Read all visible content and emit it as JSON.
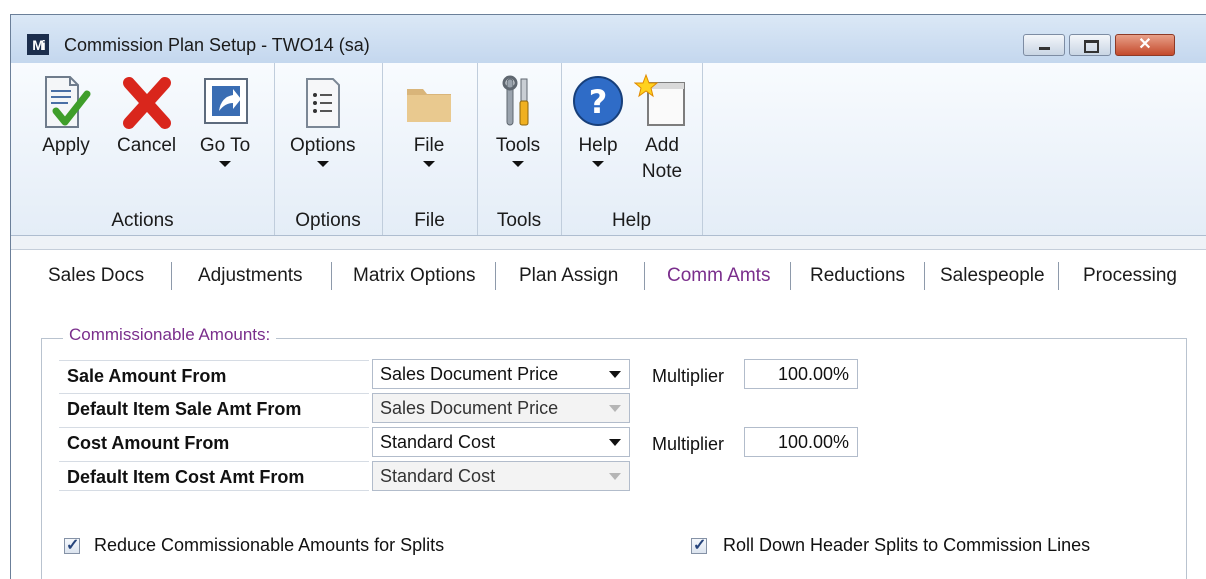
{
  "window": {
    "logo": "Mi",
    "title": "Commission Plan Setup  -  TWO14 (sa)",
    "close_glyph": "✕"
  },
  "ribbon": {
    "groups": [
      {
        "label": "Actions",
        "buttons": [
          {
            "label": "Apply",
            "icon": "apply-check-icon"
          },
          {
            "label": "Cancel",
            "icon": "cancel-x-icon"
          },
          {
            "label": "Go To",
            "icon": "goto-arrow-icon",
            "dropdown": true
          }
        ]
      },
      {
        "label": "Options",
        "buttons": [
          {
            "label": "Options",
            "icon": "options-list-icon",
            "dropdown": true
          }
        ]
      },
      {
        "label": "File",
        "buttons": [
          {
            "label": "File",
            "icon": "folder-icon",
            "dropdown": true
          }
        ]
      },
      {
        "label": "Tools",
        "buttons": [
          {
            "label": "Tools",
            "icon": "tools-icon",
            "dropdown": true
          }
        ]
      },
      {
        "label": "Help",
        "buttons": [
          {
            "label": "Help",
            "icon": "help-icon",
            "dropdown": true
          },
          {
            "label": "Add Note",
            "icon": "add-note-icon"
          }
        ]
      }
    ]
  },
  "tabs": [
    {
      "label": "Sales Docs"
    },
    {
      "label": "Adjustments"
    },
    {
      "label": "Matrix Options"
    },
    {
      "label": "Plan Assign"
    },
    {
      "label": "Comm Amts",
      "active": true
    },
    {
      "label": "Reductions"
    },
    {
      "label": "Salespeople"
    },
    {
      "label": "Processing"
    }
  ],
  "section": {
    "title": "Commissionable Amounts:",
    "rows": [
      {
        "label": "Sale Amount From",
        "value": "Sales Document Price",
        "enabled": true,
        "multiplier_label": "Multiplier",
        "multiplier": "100.00%"
      },
      {
        "label": "Default Item Sale Amt From",
        "value": "Sales Document Price",
        "enabled": false
      },
      {
        "label": "Cost Amount From",
        "value": "Standard Cost",
        "enabled": true,
        "multiplier_label": "Multiplier",
        "multiplier": "100.00%"
      },
      {
        "label": "Default Item Cost Amt From",
        "value": "Standard Cost",
        "enabled": false
      }
    ],
    "checkboxes": [
      {
        "label": "Reduce Commissionable Amounts for Splits",
        "checked": true
      },
      {
        "label": "Roll Down Header Splits to Commission Lines",
        "checked": true
      }
    ]
  },
  "colors": {
    "accent_purple": "#7a2e8c",
    "close_red": "#c44a2c"
  }
}
